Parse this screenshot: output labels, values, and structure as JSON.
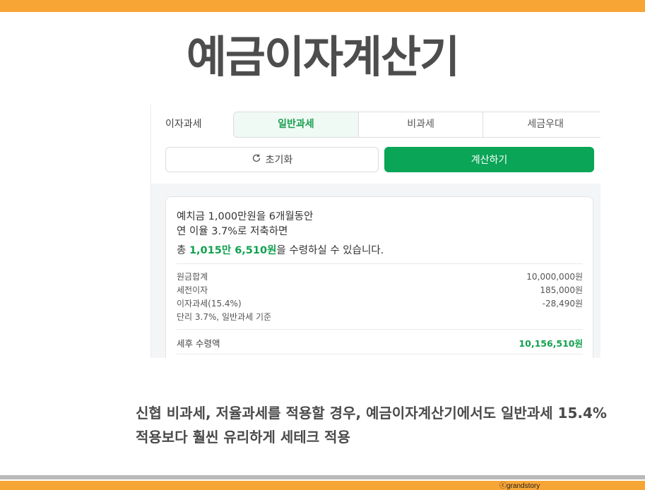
{
  "title": "예금이자계산기",
  "calculator": {
    "tax_label": "이자과세",
    "tax_tabs": [
      "일반과세",
      "비과세",
      "세금우대"
    ],
    "active_tab": "일반과세",
    "reset_label": "초기화",
    "calc_label": "계산하기"
  },
  "result": {
    "line1": "예치금 1,000만원을 6개월동안",
    "line2": "연 이율 3.7%로 저축하면",
    "line3_prefix": "총 ",
    "line3_amount": "1,015만 6,510원",
    "line3_suffix": "을 수령하실 수 있습니다.",
    "rows": [
      {
        "label": "원금합계",
        "value": "10,000,000원"
      },
      {
        "label": "세전이자",
        "value": "185,000원"
      },
      {
        "label": "이자과세(15.4%)",
        "value": "-28,490원"
      },
      {
        "label": "단리 3.7%, 일반과세 기준",
        "value": ""
      }
    ],
    "total_label": "세후 수령액",
    "total_value": "10,156,510원"
  },
  "caption": "신협 비과세, 저율과세를 적용할 경우, 예금이자계산기에서도 일반과세 15.4% 적용보다 훨씬 유리하게 세테크 적용",
  "copyright": "ⓒgrandstory",
  "colors": {
    "accent_orange": "#f7a535",
    "accent_green": "#0aa557"
  },
  "icons": {
    "reset": "refresh-icon"
  }
}
